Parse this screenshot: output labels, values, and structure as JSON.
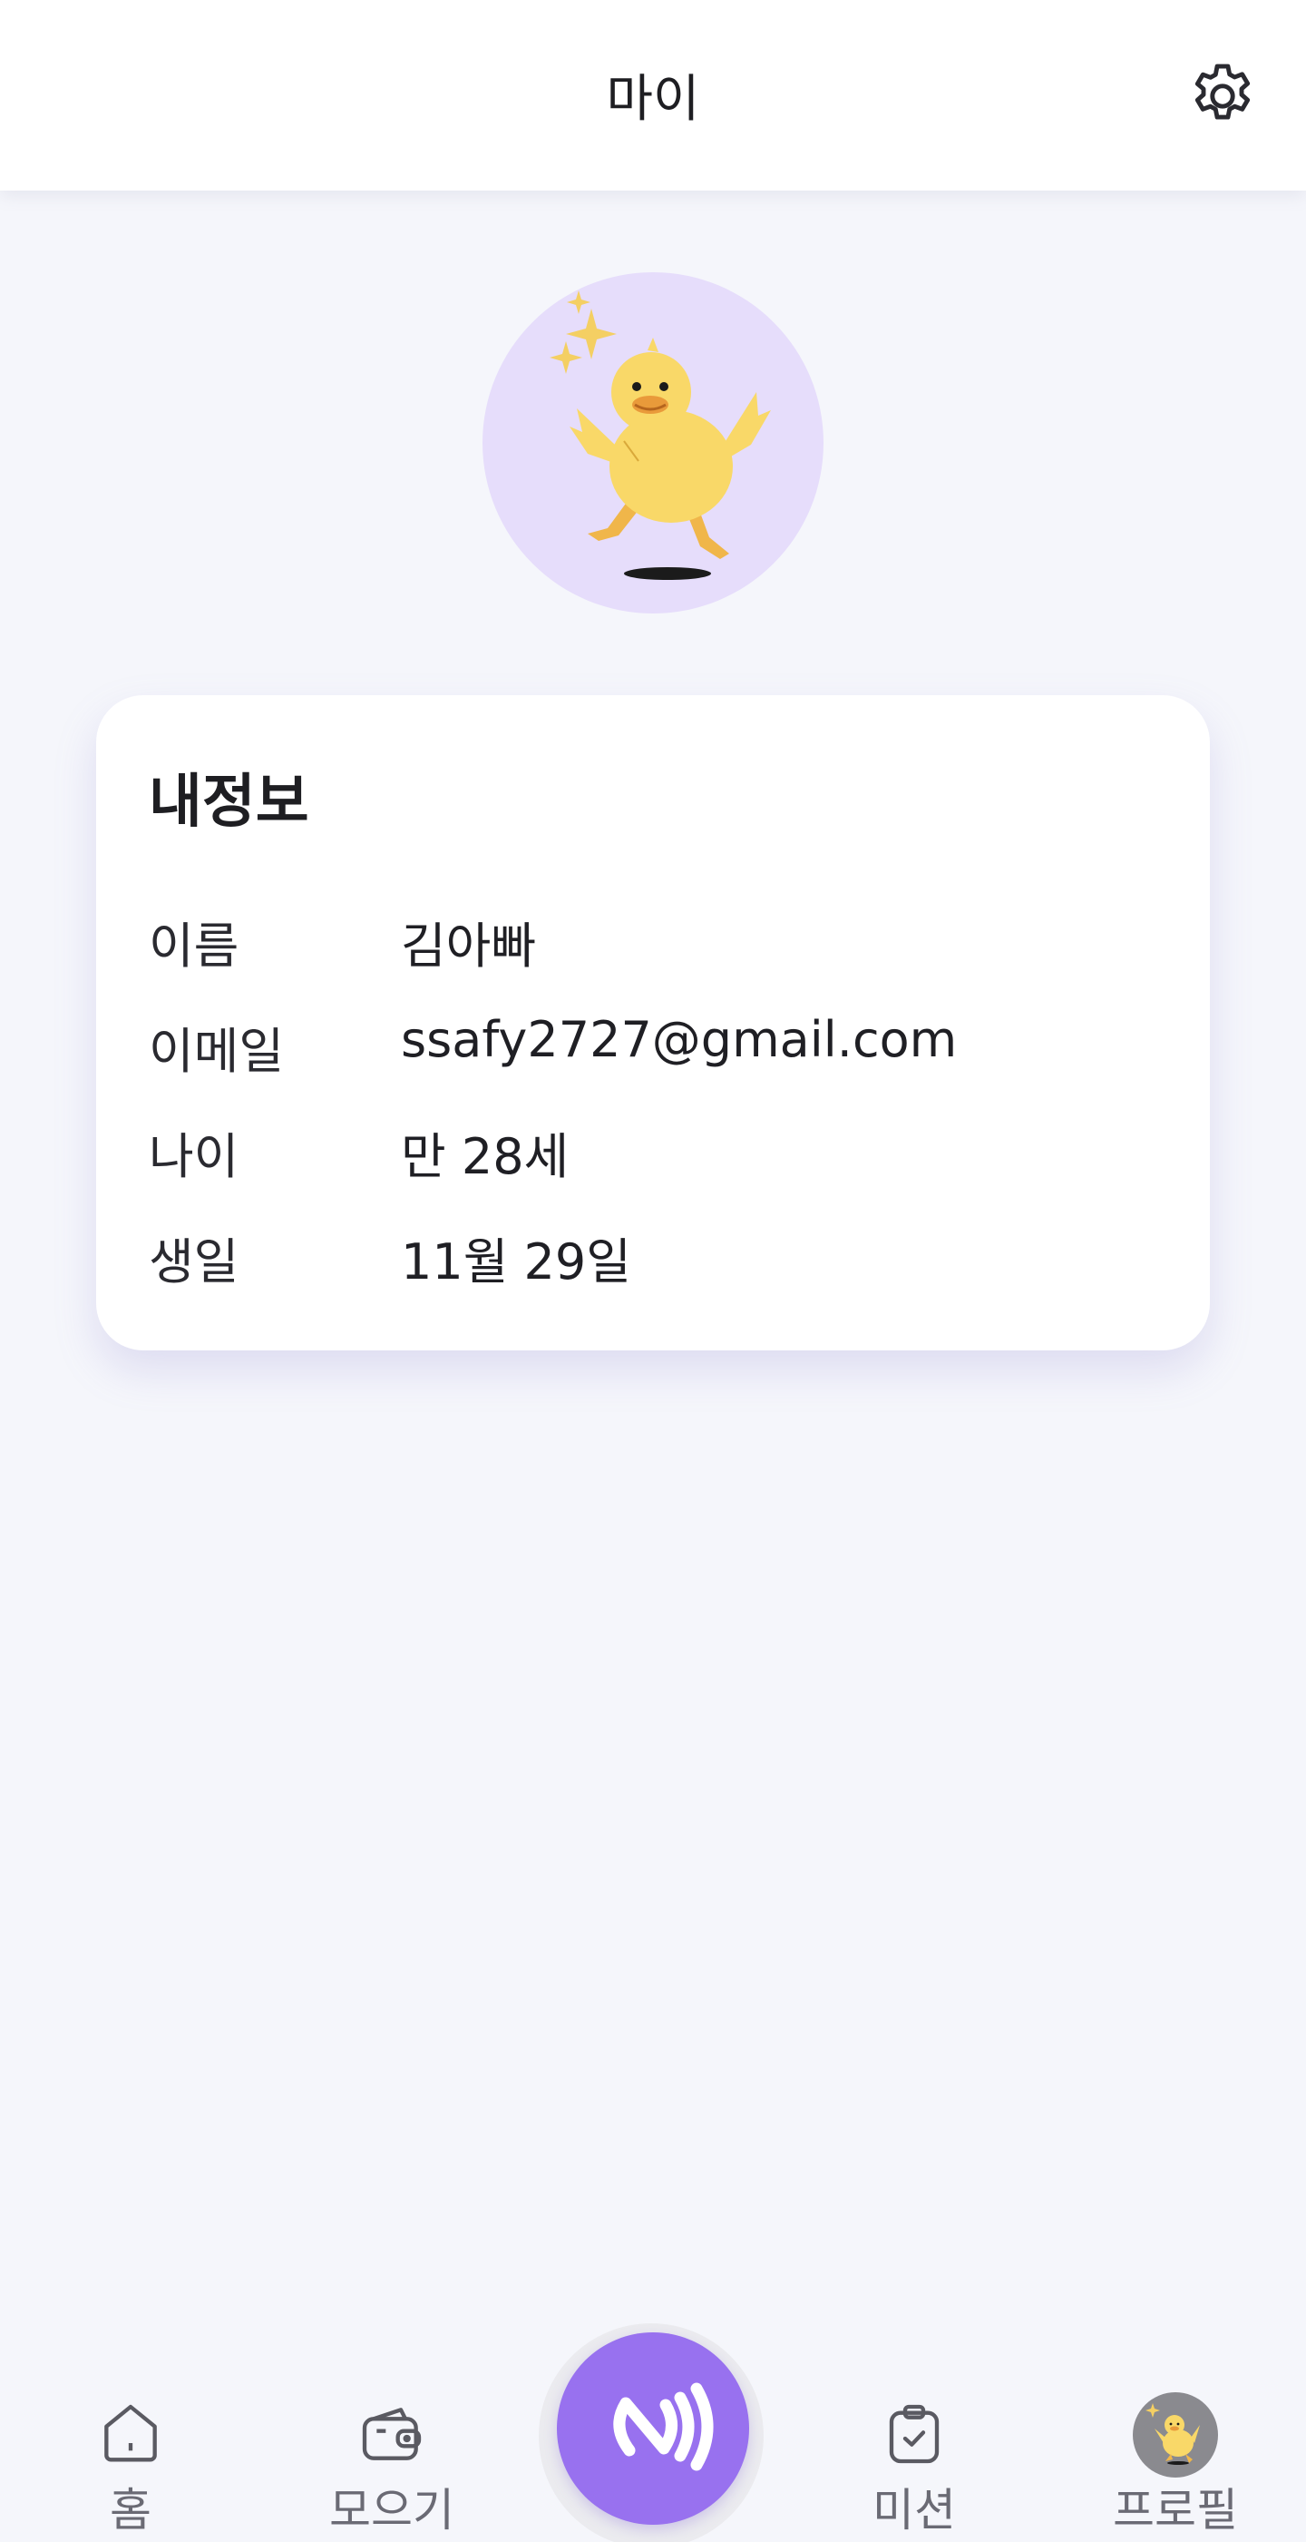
{
  "header": {
    "title": "마이",
    "settings_icon": "gear-icon"
  },
  "avatar": {
    "icon": "duck-character-icon",
    "background": "#e6ddfb"
  },
  "info_card": {
    "title": "내정보",
    "rows": [
      {
        "label": "이름",
        "value": "김아빠"
      },
      {
        "label": "이메일",
        "value": "ssafy2727@gmail.com"
      },
      {
        "label": "나이",
        "value": "만 28세"
      },
      {
        "label": "생일",
        "value": "11월 29일"
      }
    ]
  },
  "tabbar": {
    "items": [
      {
        "label": "홈",
        "icon": "home-icon"
      },
      {
        "label": "모으기",
        "icon": "wallet-icon"
      },
      {
        "label": "",
        "icon": "nfc-icon"
      },
      {
        "label": "미션",
        "icon": "clipboard-check-icon"
      },
      {
        "label": "프로필",
        "icon": "duck-avatar-icon"
      }
    ],
    "accent": "#9871ef"
  }
}
